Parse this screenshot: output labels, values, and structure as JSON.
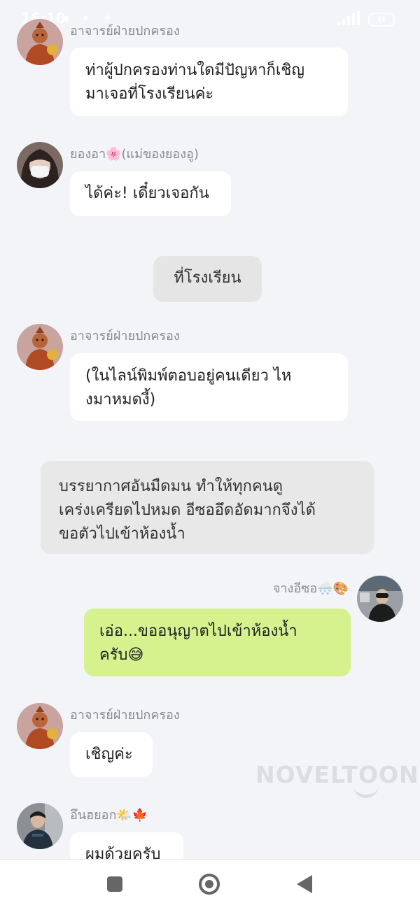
{
  "status": {
    "time": "16:10"
  },
  "messages": [
    {
      "sender": "อาจารย์ฝ่ายปกครอง",
      "text": "ท่าผู้ปกครองท่านใดมีปัญหาก็เชิญมาเจอที่โรงเรียนค่ะ",
      "lines": [
        "ท่าผู้ปกครองท่านใดมีปัญหาก็เชิญ",
        "มาเจอที่โรงเรียนค่ะ"
      ]
    },
    {
      "sender": "ยองอา🌸(แม่ของยองอู)",
      "text": "ได้ค่ะ! เดี๋ยวเจอกัน"
    },
    {
      "scene": "ที่โรงเรียน"
    },
    {
      "sender": "อาจารย์ฝ่ายปกครอง",
      "lines": [
        "(ในไลน์พิมพ์ตอบอยู่คนเดียว ไห",
        "งมาหมดงี้)"
      ]
    },
    {
      "narration_lines": [
        "บรรยากาศอันมืดมน ทำให้ทุกคนดู",
        "เคร่งเครียดไปหมด อีซออึดอัดมากจึงได้",
        "ขอตัวไปเข้าห้องน้ำ"
      ]
    },
    {
      "sender": "จางอีซอ🌨️🎨",
      "lines": [
        "เอ่อ...ขออนุญาตไปเข้าห้องน้ำ",
        "ครับ😅"
      ]
    },
    {
      "sender": "อาจารย์ฝ่ายปกครอง",
      "text": "เชิญค่ะ"
    },
    {
      "sender": "อึนฮยอก🌤️🍁",
      "text": "ผมด้วยครับ"
    }
  ],
  "watermark": "NOVELTOON",
  "icons": {
    "nav": [
      "recent-apps-icon",
      "home-icon",
      "back-icon"
    ]
  },
  "colors": {
    "my_bubble": "#d6f28e",
    "bubble": "#ffffff",
    "background": "#f3f4f8"
  }
}
